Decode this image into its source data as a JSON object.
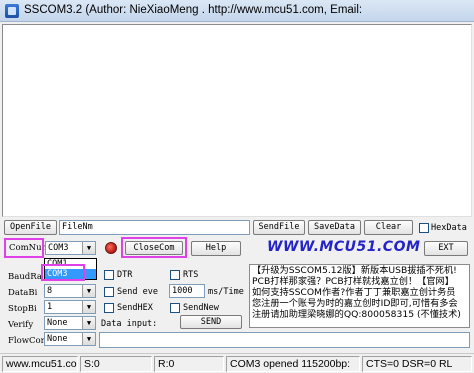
{
  "window": {
    "title": "SSCOM3.2 (Author: NieXiaoMeng . http://www.mcu51.com, Email: "
  },
  "file_row": {
    "open_file": "OpenFile",
    "file_name": "FileNm",
    "send_file": "SendFile",
    "save_data": "SaveData",
    "clear": "Clear",
    "hex_display": "HexData"
  },
  "port_row": {
    "com_num_label": "ComNum",
    "com_value": "COM3",
    "close_com": "CloseCom",
    "help": "Help",
    "logo": "WWW.MCU51.COM",
    "ext": "EXT"
  },
  "settings": {
    "baud_label": "BaudRa",
    "databits_label": "DataBi",
    "databits_value": "8",
    "stopbits_label": "StopBi",
    "stopbits_value": "1",
    "verify_label": "Verify",
    "verify_value": "None",
    "flowcontrol_label": "FlowCon",
    "flowcontrol_value": "None"
  },
  "dropdown": {
    "options": [
      "COM1",
      "COM3"
    ],
    "selected": "COM3"
  },
  "options": {
    "dtr": "DTR",
    "rts": "RTS",
    "send_every": "Send eve",
    "interval_value": "1000",
    "interval_unit": "ms/Time",
    "send_hex": "SendHEX",
    "send_new": "SendNew",
    "data_input_label": "Data input:",
    "send": "SEND"
  },
  "ad_panel": {
    "lines": [
      "【升级为SSCOM5.12版】新版本USB拔插不死机!",
      "PCB打样那家强？PCB打样就找嘉立创！【官网】",
      "如何支持SSCOM作者?作者丁丁兼职嘉立创计务员",
      "您注册一个账号为时的嘉立创时ID即可,可惜有多会",
      "注册请加助理梁晓娜的QQ:800058315 (不懂技术)"
    ]
  },
  "status": {
    "website": "www.mcu51.cor",
    "sent": "S:0",
    "received": "R:0",
    "port_status": "COM3 opened 115200bp:",
    "signals": "CTS=0 DSR=0 RL"
  }
}
